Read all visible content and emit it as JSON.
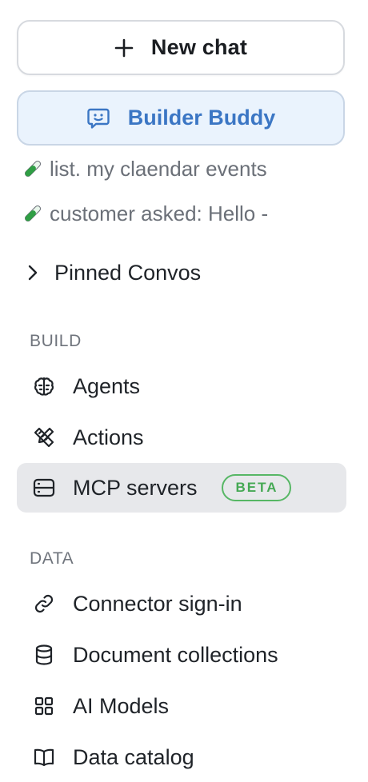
{
  "top": {
    "new_chat_label": "New chat",
    "builder_label": "Builder Buddy"
  },
  "recent_chats": [
    {
      "label": "list. my claendar events",
      "icon": "test-tube-icon"
    },
    {
      "label": "customer asked: Hello -",
      "icon": "test-tube-icon"
    }
  ],
  "pinned": {
    "label": "Pinned Convos",
    "icon": "chevron-right-icon"
  },
  "build": {
    "heading": "BUILD",
    "items": [
      {
        "label": "Agents",
        "icon": "brain-icon"
      },
      {
        "label": "Actions",
        "icon": "tools-icon"
      },
      {
        "label": "MCP servers",
        "icon": "server-icon",
        "badge": "BETA",
        "active": true
      }
    ]
  },
  "data_section": {
    "heading": "DATA",
    "items": [
      {
        "label": "Connector sign-in",
        "icon": "link-icon"
      },
      {
        "label": "Document collections",
        "icon": "database-icon"
      },
      {
        "label": "AI Models",
        "icon": "grid-icon"
      },
      {
        "label": "Data catalog",
        "icon": "book-icon"
      }
    ]
  },
  "colors": {
    "accent": "#3b76c4",
    "builder_bg": "#eaf3fd",
    "active_bg": "#e7e8eb",
    "beta_green": "#46a955",
    "test_tube_green": "#2f9e44"
  }
}
